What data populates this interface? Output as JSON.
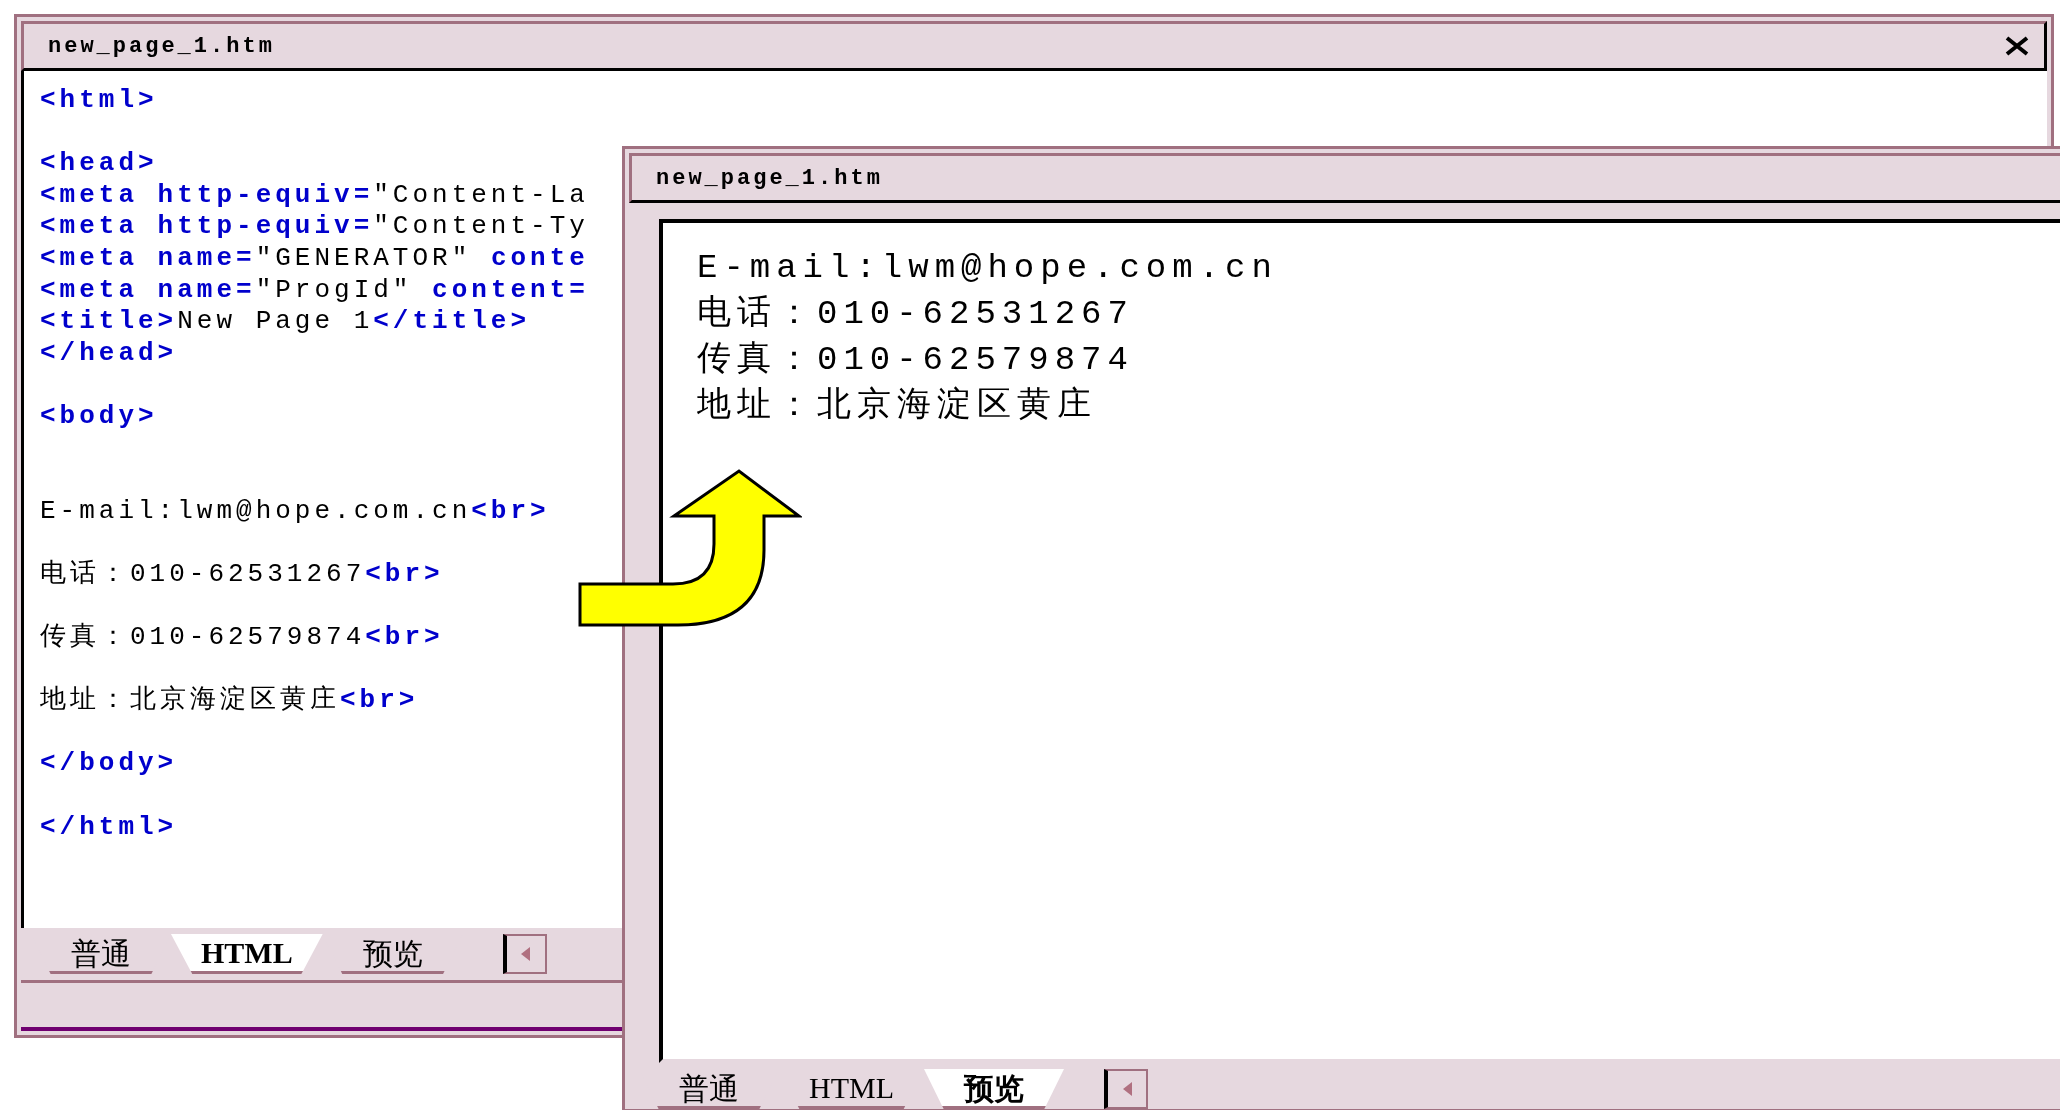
{
  "editor_window": {
    "title": "new_page_1.htm",
    "code_lines": [
      {
        "kind": "code",
        "segments": [
          {
            "kind": "tag",
            "text": "<html>"
          }
        ]
      },
      {
        "kind": "blank"
      },
      {
        "kind": "code",
        "segments": [
          {
            "kind": "tag",
            "text": "<head>"
          }
        ]
      },
      {
        "kind": "code",
        "segments": [
          {
            "kind": "tag",
            "text": "<meta http-equiv="
          },
          {
            "kind": "text",
            "text": "\"Content-La"
          }
        ]
      },
      {
        "kind": "code",
        "segments": [
          {
            "kind": "tag",
            "text": "<meta http-equiv="
          },
          {
            "kind": "text",
            "text": "\"Content-Ty"
          }
        ]
      },
      {
        "kind": "code",
        "segments": [
          {
            "kind": "tag",
            "text": "<meta name="
          },
          {
            "kind": "text",
            "text": "\"GENERATOR\" "
          },
          {
            "kind": "tag",
            "text": "conte"
          }
        ]
      },
      {
        "kind": "code",
        "segments": [
          {
            "kind": "tag",
            "text": "<meta name="
          },
          {
            "kind": "text",
            "text": "\"ProgId\" "
          },
          {
            "kind": "tag",
            "text": "content="
          }
        ]
      },
      {
        "kind": "code",
        "segments": [
          {
            "kind": "tag",
            "text": "<title>"
          },
          {
            "kind": "text",
            "text": "New Page 1"
          },
          {
            "kind": "tag",
            "text": "</title>"
          }
        ]
      },
      {
        "kind": "code",
        "segments": [
          {
            "kind": "tag",
            "text": "</head>"
          }
        ]
      },
      {
        "kind": "blank"
      },
      {
        "kind": "code",
        "segments": [
          {
            "kind": "tag",
            "text": "<body>"
          }
        ]
      },
      {
        "kind": "blank"
      },
      {
        "kind": "blank"
      },
      {
        "kind": "code",
        "segments": [
          {
            "kind": "text",
            "text": "E-mail:lwm@hope.com.cn"
          },
          {
            "kind": "tag",
            "text": "<br>"
          }
        ]
      },
      {
        "kind": "blank"
      },
      {
        "kind": "code",
        "segments": [
          {
            "kind": "text",
            "text": "电话：010-62531267"
          },
          {
            "kind": "tag",
            "text": "<br>"
          }
        ]
      },
      {
        "kind": "blank"
      },
      {
        "kind": "code",
        "segments": [
          {
            "kind": "text",
            "text": "传真：010-62579874"
          },
          {
            "kind": "tag",
            "text": "<br>"
          }
        ]
      },
      {
        "kind": "blank"
      },
      {
        "kind": "code",
        "segments": [
          {
            "kind": "text",
            "text": "地址：北京海淀区黄庄"
          },
          {
            "kind": "tag",
            "text": "<br>"
          }
        ]
      },
      {
        "kind": "blank"
      },
      {
        "kind": "code",
        "segments": [
          {
            "kind": "tag",
            "text": "</body>"
          }
        ]
      },
      {
        "kind": "blank"
      },
      {
        "kind": "code",
        "segments": [
          {
            "kind": "tag",
            "text": "</html>"
          }
        ]
      }
    ],
    "tabs": [
      {
        "label": "普通",
        "selected": false
      },
      {
        "label": "HTML",
        "selected": true
      },
      {
        "label": "预览",
        "selected": false
      }
    ]
  },
  "preview_window": {
    "title": "new_page_1.htm",
    "preview_lines": [
      "E-mail:lwm@hope.com.cn",
      "电话：010-62531267",
      "传真：010-62579874",
      "地址：北京海淀区黄庄"
    ],
    "tabs": [
      {
        "label": "普通",
        "selected": false
      },
      {
        "label": "HTML",
        "selected": false
      },
      {
        "label": "预览",
        "selected": true
      }
    ]
  }
}
